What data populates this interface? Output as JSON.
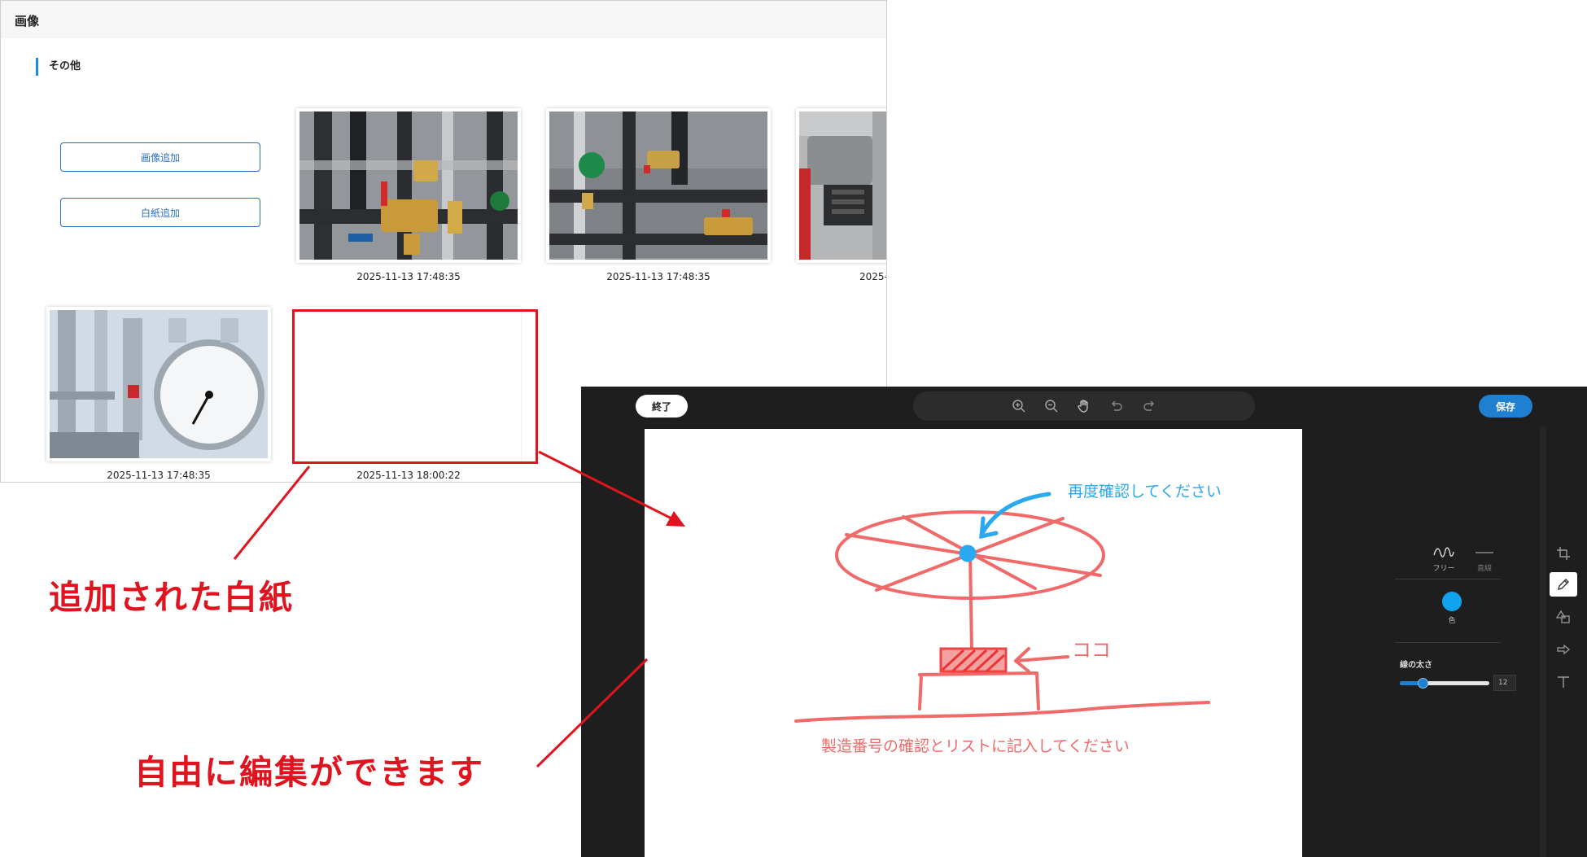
{
  "app": {
    "title": "画像",
    "section_title": "その他",
    "buttons": {
      "add_image": "画像追加",
      "add_blank": "白紙追加"
    },
    "thumbnails": [
      {
        "timestamp": "2025-11-13 17:48:35",
        "kind": "photo-pipes-valves"
      },
      {
        "timestamp": "2025-11-13 17:48:35",
        "kind": "photo-pipes-pump"
      },
      {
        "timestamp": "2025-",
        "kind": "photo-machine-spring"
      },
      {
        "timestamp": "2025-11-13 17:48:35",
        "kind": "photo-pressure-gauge"
      },
      {
        "timestamp": "2025-11-13 18:00:22",
        "kind": "blank-paper"
      }
    ]
  },
  "annotations": {
    "blank_added": "追加された白紙",
    "free_edit": "自由に編集ができます",
    "color": "#e0141e"
  },
  "editor": {
    "finish_label": "終了",
    "save_label": "保存",
    "toolbar_icons": [
      "zoom-in-icon",
      "zoom-out-icon",
      "hand-icon",
      "undo-icon",
      "redo-icon"
    ],
    "drawing": {
      "text_recheck": "再度確認してください",
      "text_here": "ココ",
      "text_serial": "製造番号の確認とリストに記入してください",
      "pen_red": "#f06a6a",
      "pen_blue": "#2aa8f0"
    },
    "panel": {
      "pen_free": "フリー",
      "pen_line": "直線",
      "color_label": "色",
      "current_color": "#11a3ef",
      "line_width_label": "線の太さ",
      "line_width_value": "12",
      "line_width_fraction": 0.25
    },
    "right_tools": [
      "crop-icon",
      "pencil-icon",
      "shapes-icon",
      "arrow-icon",
      "text-icon"
    ],
    "active_tool": "pencil-icon"
  }
}
